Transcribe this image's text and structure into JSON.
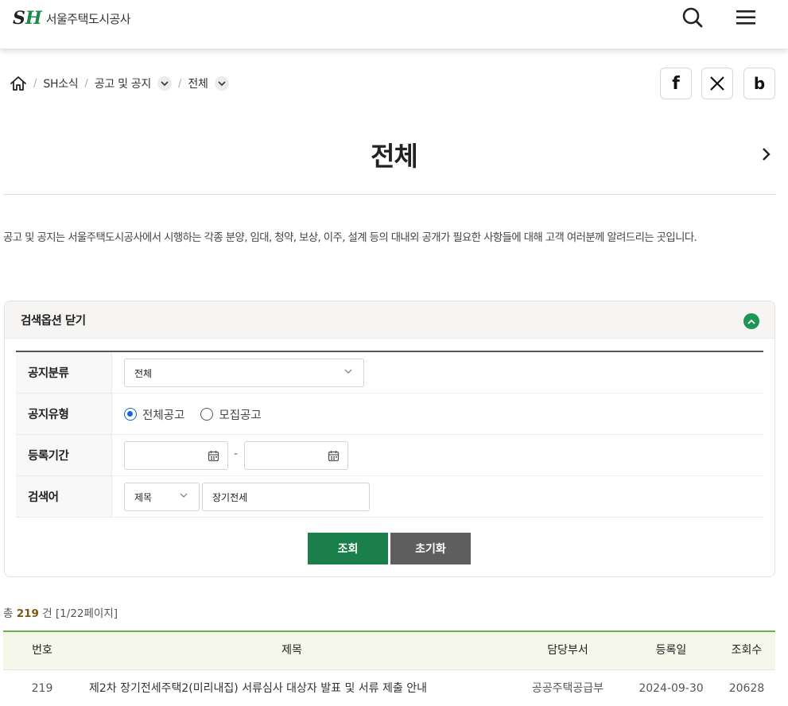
{
  "header": {
    "logo_mark_s": "S",
    "logo_mark_h": "H",
    "logo_text": "서울주택도시공사"
  },
  "breadcrumb": {
    "items": [
      "SH소식",
      "공고 및 공지",
      "전체"
    ]
  },
  "share": {
    "facebook_label": "f",
    "blog_label": "b"
  },
  "page_title": "전체",
  "intro_text": "공고 및 공지는 서울주택도시공사에서 시행하는 각종 분양, 임대, 청약, 보상, 이주, 설계 등의 대내외 공개가 필요한 사항들에 대해 고객 여러분께 알려드리는 곳입니다.",
  "search_panel": {
    "toggle_label": "검색옵션 닫기",
    "rows": {
      "category_label": "공지분류",
      "category_value": "전체",
      "type_label": "공지유형",
      "type_options": [
        "전체공고",
        "모집공고"
      ],
      "type_selected": "전체공고",
      "period_label": "등록기간",
      "period_start": "",
      "period_end": "",
      "period_separator": "-",
      "keyword_label": "검색어",
      "keyword_field": "제목",
      "keyword_value": "장기전세"
    },
    "search_button": "조회",
    "reset_button": "초기화"
  },
  "results": {
    "count_prefix": "총",
    "count": "219",
    "count_suffix": "건 [1/22페이지]",
    "columns": [
      "번호",
      "제목",
      "담당부서",
      "등록일",
      "조회수"
    ],
    "rows": [
      {
        "no": "219",
        "title": "제2차 장기전세주택2(미리내집) 서류심사 대상자 발표 및 서류 제출 안내",
        "dept": "공공주택공급부",
        "date": "2024-09-30",
        "views": "20628"
      }
    ]
  },
  "colors": {
    "brand_green": "#1a7f4b",
    "toggle_green": "#1d9656",
    "reset_gray": "#5e5e5e",
    "table_accent": "#6fb04a",
    "radio_blue": "#1565d8"
  }
}
